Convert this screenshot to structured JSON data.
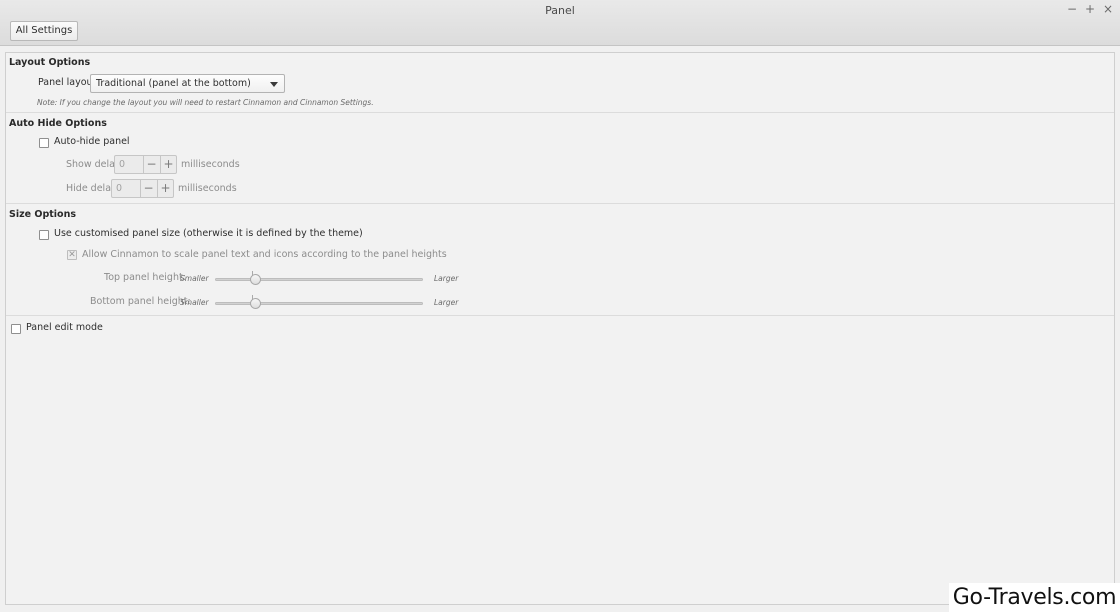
{
  "window": {
    "title": "Panel",
    "controls": {
      "minimize": "−",
      "maximize": "+",
      "close": "×"
    }
  },
  "toolbar": {
    "all_settings_label": "All Settings"
  },
  "layout_options": {
    "title": "Layout Options",
    "panel_layout_label": "Panel layout",
    "panel_layout_value": "Traditional (panel at the bottom)",
    "note": "Note: If you change the layout you will need to restart Cinnamon and Cinnamon Settings."
  },
  "auto_hide_options": {
    "title": "Auto Hide Options",
    "auto_hide_label": "Auto-hide panel",
    "auto_hide_checked": false,
    "show_delay_label": "Show delay",
    "show_delay_value": "0",
    "hide_delay_label": "Hide delay",
    "hide_delay_value": "0",
    "units": "milliseconds",
    "minus": "−",
    "plus": "+"
  },
  "size_options": {
    "title": "Size Options",
    "custom_size_label": "Use customised panel size (otherwise it is defined by the theme)",
    "custom_size_checked": false,
    "scale_label": "Allow Cinnamon to scale panel text and icons according to the panel heights",
    "scale_checked": true,
    "top_height_label": "Top panel height:",
    "bottom_height_label": "Bottom panel height:",
    "smaller": "Smaller",
    "larger": "Larger",
    "top_height_fraction": 0.18,
    "bottom_height_fraction": 0.18
  },
  "edit_mode": {
    "label": "Panel edit mode",
    "checked": false
  },
  "watermark": "Go-Travels.com",
  "icons": {
    "combo_arrow": "chevron-down-icon",
    "checkmark": "checkmark-icon"
  }
}
